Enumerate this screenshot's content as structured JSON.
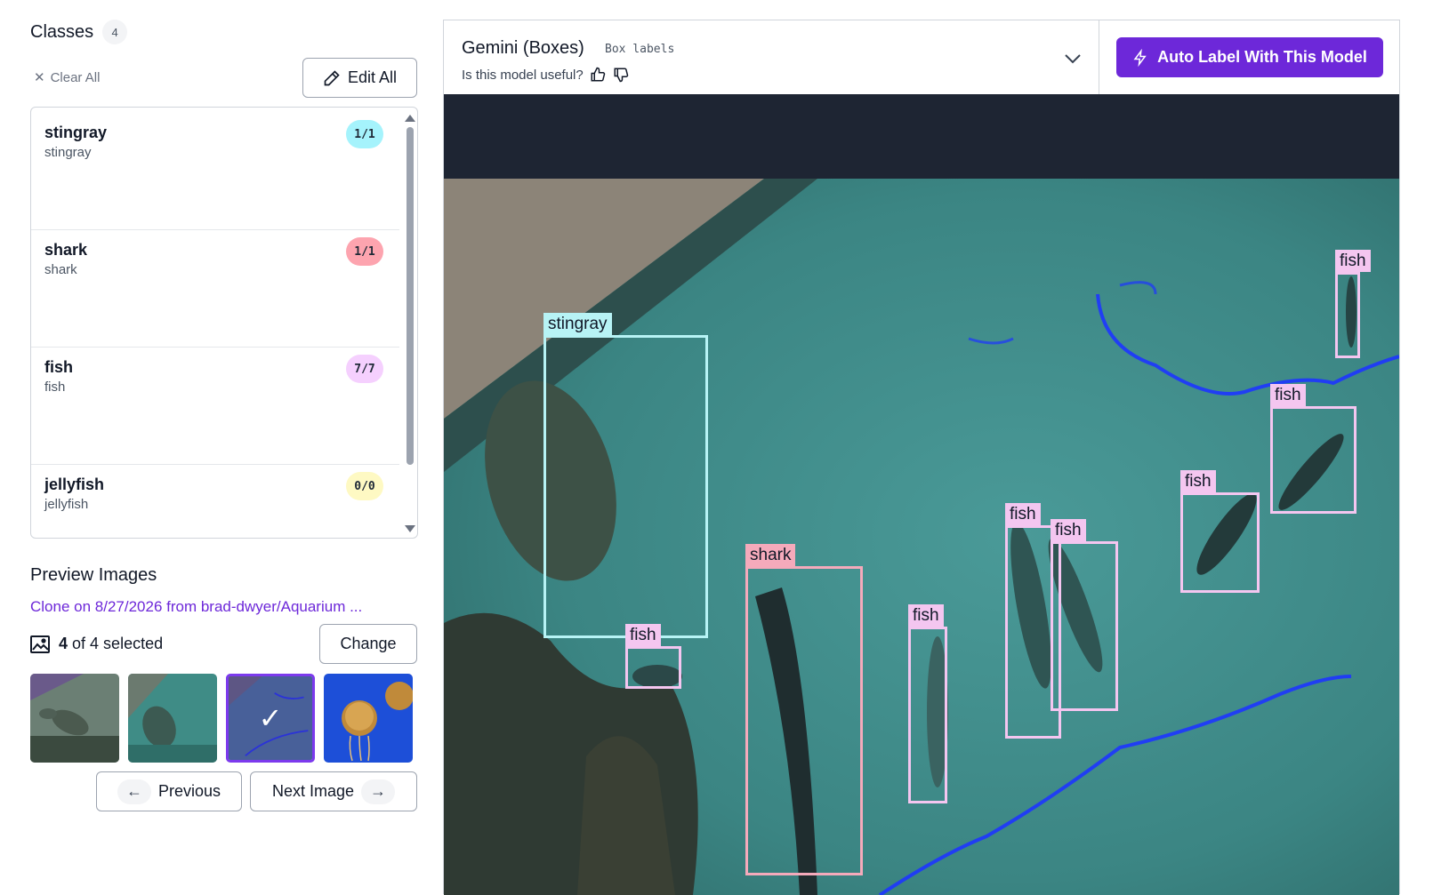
{
  "classes_panel": {
    "title": "Classes",
    "count": "4",
    "clear_all": "Clear All",
    "edit_all": "Edit All",
    "items": [
      {
        "name": "stingray",
        "sub": "stingray",
        "count": "1/1",
        "color": "#a5f3fc"
      },
      {
        "name": "shark",
        "sub": "shark",
        "count": "1/1",
        "color": "#fda4af"
      },
      {
        "name": "fish",
        "sub": "fish",
        "count": "7/7",
        "color": "#f5d0fe"
      },
      {
        "name": "jellyfish",
        "sub": "jellyfish",
        "count": "0/0",
        "color": "#fef9c3"
      }
    ]
  },
  "preview": {
    "title": "Preview Images",
    "clone_link": "Clone on 8/27/2026 from brad-dwyer/Aquarium ...",
    "selected_count": "4",
    "selected_of": "of 4 selected",
    "change": "Change",
    "thumbnails": [
      "stingray-pool",
      "stingray-teal",
      "aquarium-blue",
      "jellyfish-blue"
    ],
    "selected_thumbnail": 2,
    "previous": "Previous",
    "next": "Next Image"
  },
  "model": {
    "name": "Gemini (Boxes)",
    "tag": "Box labels",
    "useful_prompt": "Is this model useful?",
    "auto_label": "Auto Label With This Model"
  },
  "detections": [
    {
      "label": "stingray",
      "class": "stingray"
    },
    {
      "label": "fish",
      "class": "fish"
    },
    {
      "label": "shark",
      "class": "shark"
    },
    {
      "label": "fish",
      "class": "fish"
    },
    {
      "label": "fish",
      "class": "fish"
    },
    {
      "label": "fish",
      "class": "fish"
    },
    {
      "label": "fish",
      "class": "fish"
    },
    {
      "label": "fish",
      "class": "fish"
    },
    {
      "label": "fish",
      "class": "fish"
    }
  ],
  "colors": {
    "stingray": "#b7f3f5",
    "shark": "#f5aabb",
    "fish": "#f4c6f0",
    "accent": "#6d28d9"
  }
}
